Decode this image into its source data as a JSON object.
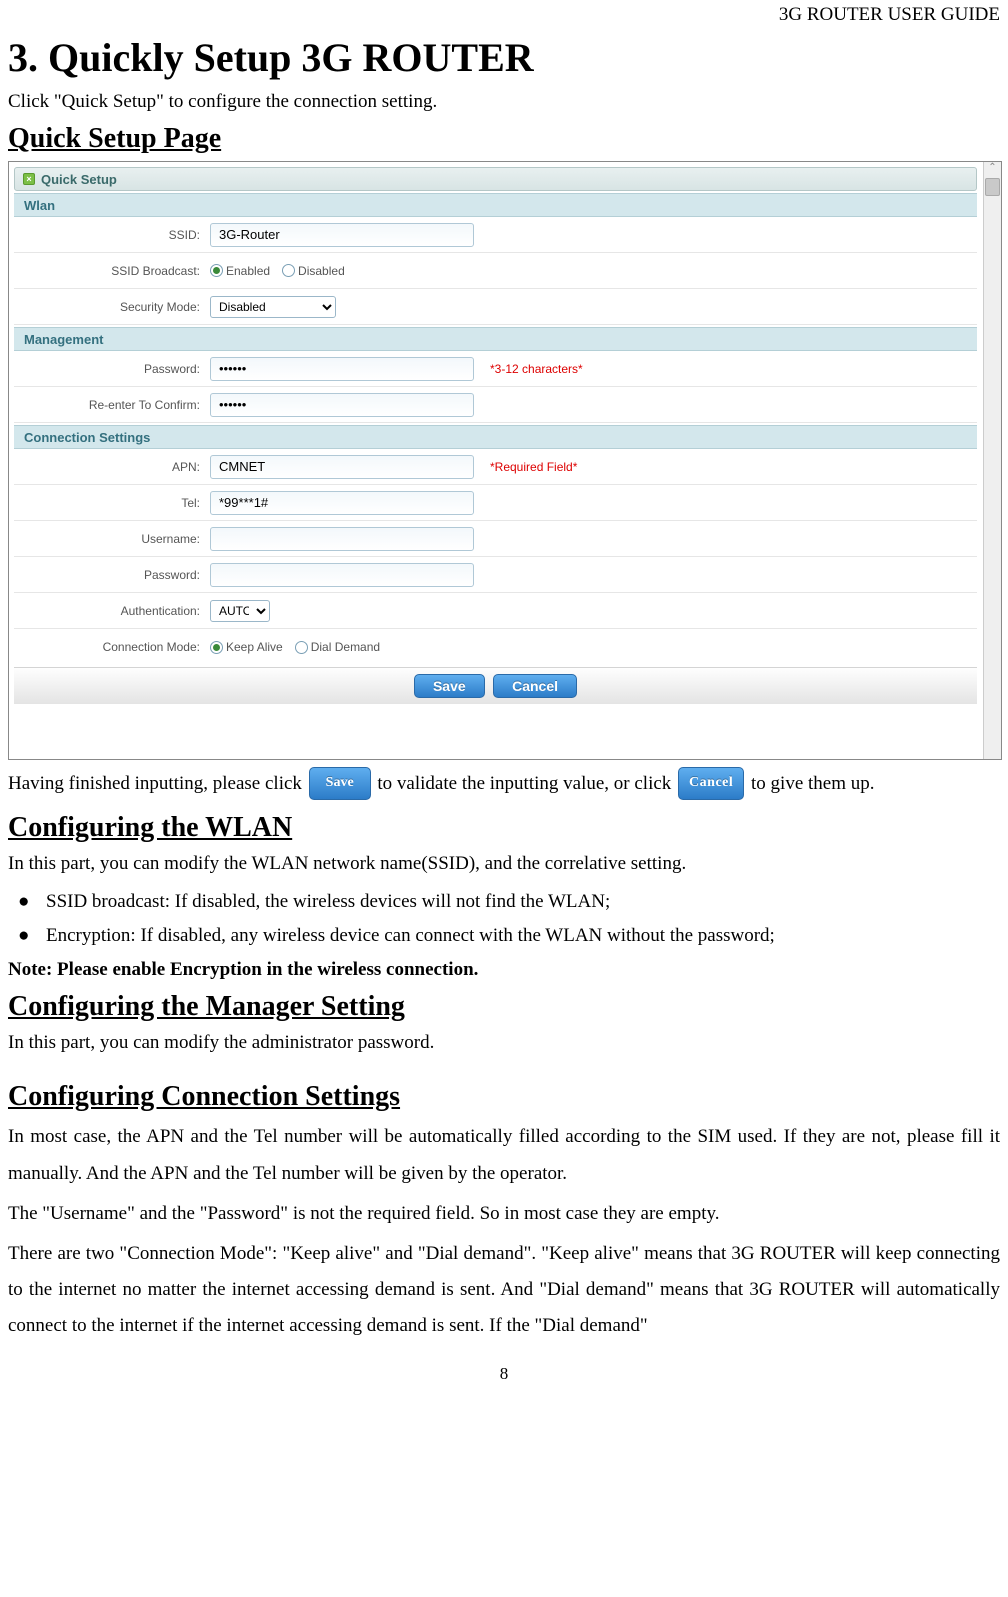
{
  "doc_header": "3G ROUTER USER GUIDE",
  "chapter_title": "3. Quickly Setup 3G ROUTER",
  "intro": "Click \"Quick Setup\" to configure the connection setting.",
  "sections": {
    "quick_setup_page": "Quick Setup Page",
    "configuring_wlan": "Configuring the WLAN",
    "configuring_manager": "Configuring the Manager Setting",
    "configuring_connection": "Configuring Connection Settings"
  },
  "screenshot": {
    "panel_title": "Quick Setup",
    "wlan_band": "Wlan",
    "wlan": {
      "ssid_label": "SSID:",
      "ssid_value": "3G-Router",
      "broadcast_label": "SSID Broadcast:",
      "broadcast_enabled": "Enabled",
      "broadcast_disabled": "Disabled",
      "security_label": "Security Mode:",
      "security_value": "Disabled"
    },
    "management_band": "Management",
    "mgmt": {
      "password_label": "Password:",
      "password_value": "••••••",
      "confirm_label": "Re-enter To Confirm:",
      "confirm_value": "••••••",
      "hint": "*3-12 characters*"
    },
    "connection_band": "Connection Settings",
    "conn": {
      "apn_label": "APN:",
      "apn_value": "CMNET",
      "apn_hint": "*Required Field*",
      "tel_label": "Tel:",
      "tel_value": "*99***1#",
      "user_label": "Username:",
      "user_value": "",
      "pass_label": "Password:",
      "pass_value": "",
      "auth_label": "Authentication:",
      "auth_value": "AUTO",
      "mode_label": "Connection Mode:",
      "mode_keep": "Keep Alive",
      "mode_dial": "Dial Demand"
    },
    "buttons": {
      "save": "Save",
      "cancel": "Cancel"
    }
  },
  "after_screenshot": {
    "part1": "Having finished inputting, please click ",
    "save_btn": "Save",
    "part2": " to validate the inputting value, or click ",
    "cancel_btn": "Cancel",
    "part3": " to give them up."
  },
  "wlan_section": {
    "intro": "In this part, you can modify the WLAN network name(SSID), and the correlative setting.",
    "bullet1": "SSID broadcast: If disabled, the wireless devices will not find the WLAN;",
    "bullet2": "Encryption: If disabled, any wireless device can connect with the WLAN without the password;",
    "note": "Note: Please enable Encryption in the wireless connection."
  },
  "manager_section": {
    "intro": "In this part, you can modify the administrator password."
  },
  "connection_section": {
    "p1": "In most case, the APN and the Tel number will be automatically filled according to the SIM used. If they are not, please fill it manually. And the APN and the Tel number will be given by the operator.",
    "p2": "The \"Username\" and the \"Password\" is not the required field. So in most case they are empty.",
    "p3": "There are two \"Connection Mode\": \"Keep alive\" and \"Dial demand\". \"Keep alive\" means that 3G ROUTER will keep connecting to the internet no matter the internet accessing demand is sent. And \"Dial demand\" means that 3G ROUTER will automatically connect to the internet if the internet accessing demand is sent. If the \"Dial demand\""
  },
  "page_number": "8"
}
